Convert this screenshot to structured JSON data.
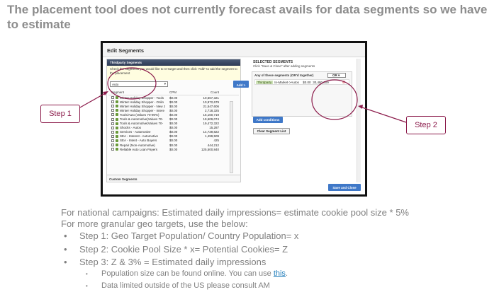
{
  "title": "The placement tool does not currently forecast avails for data segments so we have to estimate",
  "screenshot": {
    "header": "Edit Segments",
    "tab_label": "Thirdparty Segments",
    "instruction": "Check the segments you would like to re-target and then click \"Add\" to add the segment to the placement",
    "search_value": "Auto",
    "columns": [
      "Segment",
      "CPM",
      "Count"
    ],
    "rows": [
      {
        "name": "Winter Holiday Shopper - Tools",
        "cpm": "$0.00",
        "count": "10,567,321"
      },
      {
        "name": "Winter Holiday Shopper - Onlin",
        "cpm": "$0.00",
        "count": "10,972,679"
      },
      {
        "name": "Winter Holiday Shopper - New J",
        "cpm": "$0.00",
        "count": "21,547,606"
      },
      {
        "name": "Winter Holiday Shopper - Intere",
        "cpm": "$0.00",
        "count": "2,718,325"
      },
      {
        "name": "Tools/Auto (Values 70-90%)",
        "cpm": "$0.00",
        "count": "16,160,719"
      },
      {
        "name": "Tools & Automotive(Values 70-",
        "cpm": "$0.00",
        "count": "19,609,074"
      },
      {
        "name": "Tools & Automotive(Values 70-",
        "cpm": "$0.00",
        "count": "19,472,322"
      },
      {
        "name": "Shocks - Autos",
        "cpm": "$0.00",
        "count": "15,287"
      },
      {
        "name": "Services - Automotive",
        "cpm": "$0.00",
        "count": "14,739,822"
      },
      {
        "name": "SEA - Interest - Automotive",
        "cpm": "$0.00",
        "count": "1,499,509"
      },
      {
        "name": "SEA - Intent - Auto Buyers",
        "cpm": "$0.00",
        "count": "425"
      },
      {
        "name": "Repair (Non-Automotive)",
        "cpm": "$0.00",
        "count": "444,212"
      },
      {
        "name": "Reliable Auto Loan Payers",
        "cpm": "$0.00",
        "count": "125,500,840"
      }
    ],
    "custom_label": "Custom Segments",
    "add_button": "Add >",
    "selected_title": "SELECTED SEGMENTS",
    "selected_sub": "Click \"Save & Close\" after adding segments",
    "any_of_label": "Any of these segments (OR'd together)",
    "or_value": "OR",
    "selected_row": {
      "tag": "Thirdparty",
      "name": "In-Market->Autos",
      "cpm": "$0.00",
      "count": "30,480,309"
    },
    "add_conditions": "Add conditions",
    "clear_list": "Clear Segment List",
    "save_close": "Save and Close"
  },
  "annotations": {
    "step1": "Step 1",
    "step2": "Step 2",
    "color": "#8b1a4a"
  },
  "body": {
    "line1": "For national campaigns:  Estimated daily impressions= estimate cookie pool size * 5%",
    "line2": "For more granular geo targets, use the below:",
    "bullets": [
      "Step 1: Geo Target Population/ Country Population= x",
      "Step 2: Cookie Pool Size * x=  Potential Cookies= Z",
      "Step 3: Z & 3% = Estimated daily impressions"
    ],
    "sub1_text": "Population size can be found online. You can use ",
    "sub1_link": "this",
    "sub1_end": ".",
    "sub2": "Data limited outside of the US please consult AM"
  }
}
